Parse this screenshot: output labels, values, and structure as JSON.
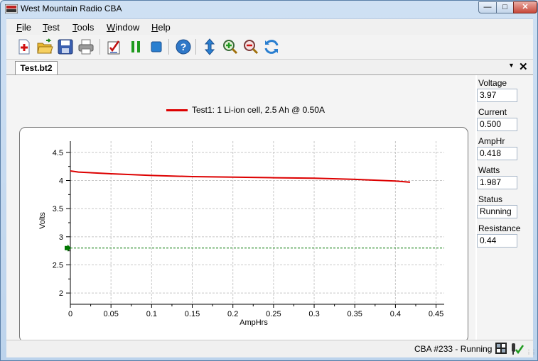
{
  "window": {
    "title": "West Mountain Radio CBA"
  },
  "menu": [
    {
      "pre": "",
      "u": "F",
      "post": "ile"
    },
    {
      "pre": "",
      "u": "T",
      "post": "est"
    },
    {
      "pre": "",
      "u": "T",
      "post": "ools"
    },
    {
      "pre": "",
      "u": "W",
      "post": "indow"
    },
    {
      "pre": "",
      "u": "H",
      "post": "elp"
    }
  ],
  "tabs": {
    "active": "Test.bt2"
  },
  "chart_data": {
    "type": "line",
    "legend": "Test1: 1 Li-ion cell, 2.5 Ah @ 0.50A",
    "xlabel": "AmpHrs",
    "ylabel": "Volts",
    "xlim": [
      0,
      0.46
    ],
    "ylim": [
      1.8,
      4.7
    ],
    "xticks": [
      "0",
      "0.05",
      "0.1",
      "0.15",
      "0.2",
      "0.25",
      "0.3",
      "0.35",
      "0.4",
      "0.45"
    ],
    "yticks": [
      "2",
      "2.5",
      "3",
      "3.5",
      "4",
      "4.5"
    ],
    "grid": true,
    "series": [
      {
        "color": "#dd0000",
        "x": [
          0,
          0.01,
          0.05,
          0.1,
          0.15,
          0.2,
          0.25,
          0.3,
          0.35,
          0.4,
          0.418
        ],
        "y": [
          4.17,
          4.15,
          4.12,
          4.09,
          4.07,
          4.06,
          4.05,
          4.04,
          4.02,
          3.99,
          3.97
        ]
      }
    ],
    "cutoff": {
      "value": 2.8,
      "color": "#007700"
    }
  },
  "readings": [
    {
      "label": "Voltage",
      "value": "3.97"
    },
    {
      "label": "Current",
      "value": "0.500"
    },
    {
      "label": "AmpHr",
      "value": "0.418"
    },
    {
      "label": "Watts",
      "value": "1.987"
    },
    {
      "label": "Status",
      "value": "Running"
    },
    {
      "label": "Resistance",
      "value": "0.44"
    }
  ],
  "status": {
    "text": "CBA #233 - Running"
  },
  "toolbar_icons": [
    "new-test-icon",
    "open-icon",
    "save-icon",
    "print-icon",
    "checklist-icon",
    "pause-icon",
    "stop-icon",
    "help-icon",
    "scroll-vertical-icon",
    "zoom-in-icon",
    "zoom-out-icon",
    "refresh-icon"
  ]
}
